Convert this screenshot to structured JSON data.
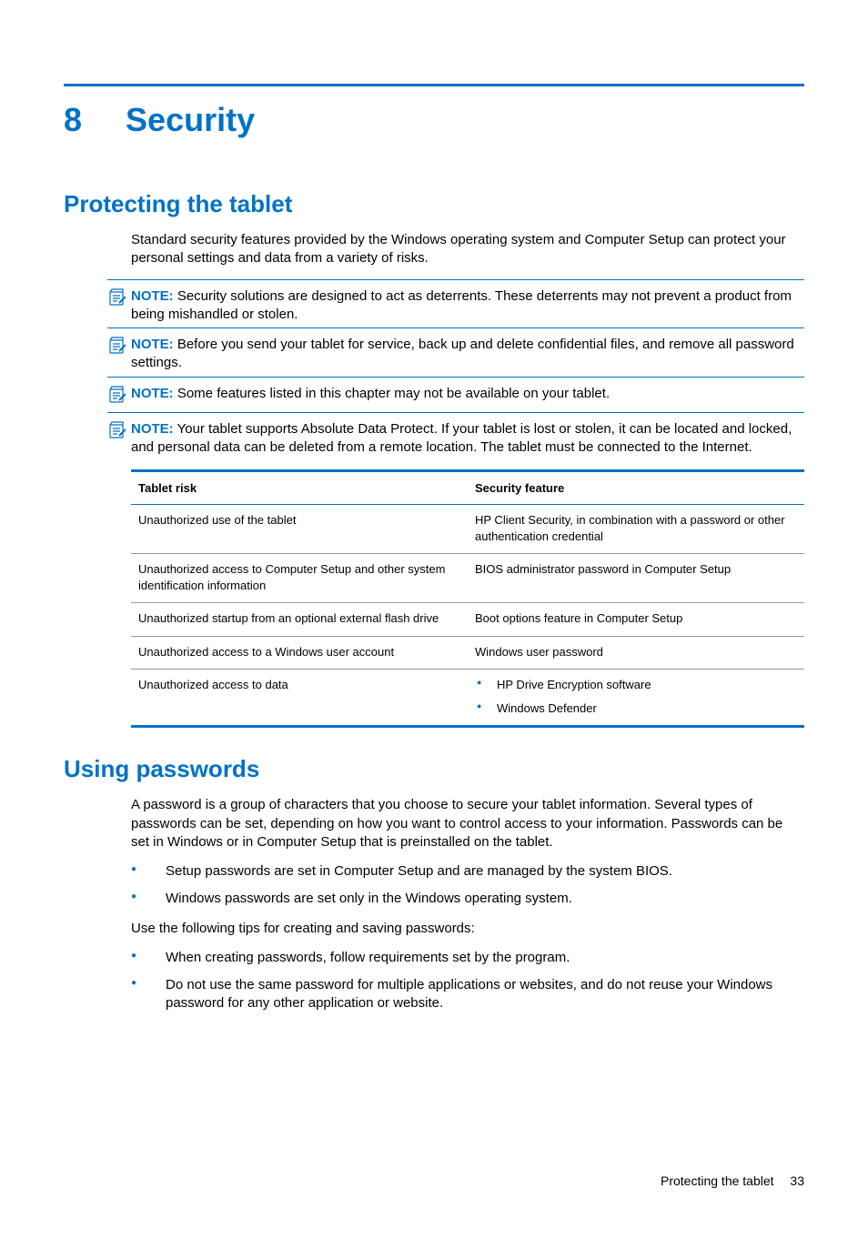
{
  "chapter": {
    "number": "8",
    "title": "Security"
  },
  "section1": {
    "heading": "Protecting the tablet",
    "intro": "Standard security features provided by the Windows operating system and Computer Setup can protect your personal settings and data from a variety of risks.",
    "notes": [
      {
        "label": "NOTE:",
        "text": " Security solutions are designed to act as deterrents. These deterrents may not prevent a product from being mishandled or stolen."
      },
      {
        "label": "NOTE:",
        "text": " Before you send your tablet for service, back up and delete confidential files, and remove all password settings."
      },
      {
        "label": "NOTE:",
        "text": " Some features listed in this chapter may not be available on your tablet."
      },
      {
        "label": "NOTE:",
        "text": " Your tablet supports Absolute Data Protect. If your tablet is lost or stolen, it can be located and locked, and personal data can be deleted from a remote location. The tablet must be connected to the Internet."
      }
    ],
    "table": {
      "headers": [
        "Tablet risk",
        "Security feature"
      ],
      "rows": [
        {
          "risk": "Unauthorized use of the tablet",
          "feature": "HP Client Security, in combination with a password or other authentication credential"
        },
        {
          "risk": "Unauthorized access to Computer Setup and other system identification information",
          "feature": "BIOS administrator password in Computer Setup"
        },
        {
          "risk": "Unauthorized startup from an optional external flash drive",
          "feature": "Boot options feature in Computer Setup"
        },
        {
          "risk": "Unauthorized access to a Windows user account",
          "feature": "Windows user password"
        },
        {
          "risk": "Unauthorized access to data",
          "feature_list": [
            "HP Drive Encryption software",
            "Windows Defender"
          ]
        }
      ]
    }
  },
  "section2": {
    "heading": "Using passwords",
    "intro": "A password is a group of characters that you choose to secure your tablet information. Several types of passwords can be set, depending on how you want to control access to your information. Passwords can be set in Windows or in Computer Setup that is preinstalled on the tablet.",
    "bullets1": [
      "Setup passwords are set in Computer Setup and are managed by the system BIOS.",
      "Windows passwords are set only in the Windows operating system."
    ],
    "tips_intro": "Use the following tips for creating and saving passwords:",
    "bullets2": [
      "When creating passwords, follow requirements set by the program.",
      "Do not use the same password for multiple applications or websites, and do not reuse your Windows password for any other application or website."
    ]
  },
  "footer": {
    "section": "Protecting the tablet",
    "page": "33"
  }
}
